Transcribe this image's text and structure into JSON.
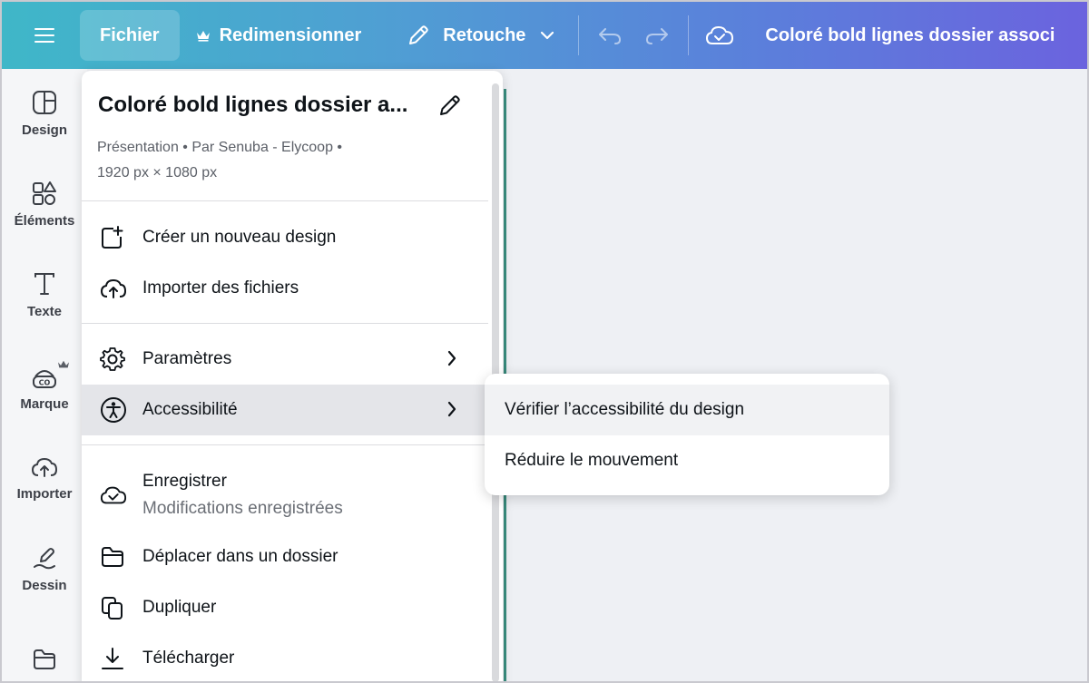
{
  "topbar": {
    "menu_icon": "hamburger-icon",
    "file_label": "Fichier",
    "resize_label": "Redimensionner",
    "retouch_label": "Retouche",
    "design_title": "Coloré bold lignes dossier associ",
    "colors": {
      "gradient_start": "#3fb7c8",
      "gradient_end": "#6b63de"
    }
  },
  "sidebar": {
    "items": [
      {
        "label": "Design",
        "icon": "layout-icon"
      },
      {
        "label": "Éléments",
        "icon": "shapes-icon"
      },
      {
        "label": "Texte",
        "icon": "text-icon"
      },
      {
        "label": "Marque",
        "icon": "brand-icon"
      },
      {
        "label": "Importer",
        "icon": "cloud-upload-icon"
      },
      {
        "label": "Dessin",
        "icon": "draw-icon"
      },
      {
        "label": "",
        "icon": "folder-icon"
      }
    ]
  },
  "menu": {
    "title": "Coloré bold lignes dossier a...",
    "meta_line1": "Présentation • Par Senuba - Elycoop •",
    "meta_line2": "1920 px × 1080 px",
    "items": [
      {
        "label": "Créer un nouveau design",
        "icon": "new-design-icon"
      },
      {
        "label": "Importer des fichiers",
        "icon": "cloud-upload-icon"
      },
      {
        "label": "Paramètres",
        "icon": "gear-icon"
      },
      {
        "label": "Accessibilité",
        "icon": "accessibility-icon"
      },
      {
        "label": "Enregistrer",
        "sublabel": "Modifications enregistrées",
        "icon": "cloud-check-icon"
      },
      {
        "label": "Déplacer dans un dossier",
        "icon": "folder-icon"
      },
      {
        "label": "Dupliquer",
        "icon": "duplicate-icon"
      },
      {
        "label": "Télécharger",
        "icon": "download-icon"
      }
    ]
  },
  "submenu": {
    "items": [
      {
        "label": "Vérifier l’accessibilité du design"
      },
      {
        "label": "Réduire le mouvement"
      }
    ]
  }
}
